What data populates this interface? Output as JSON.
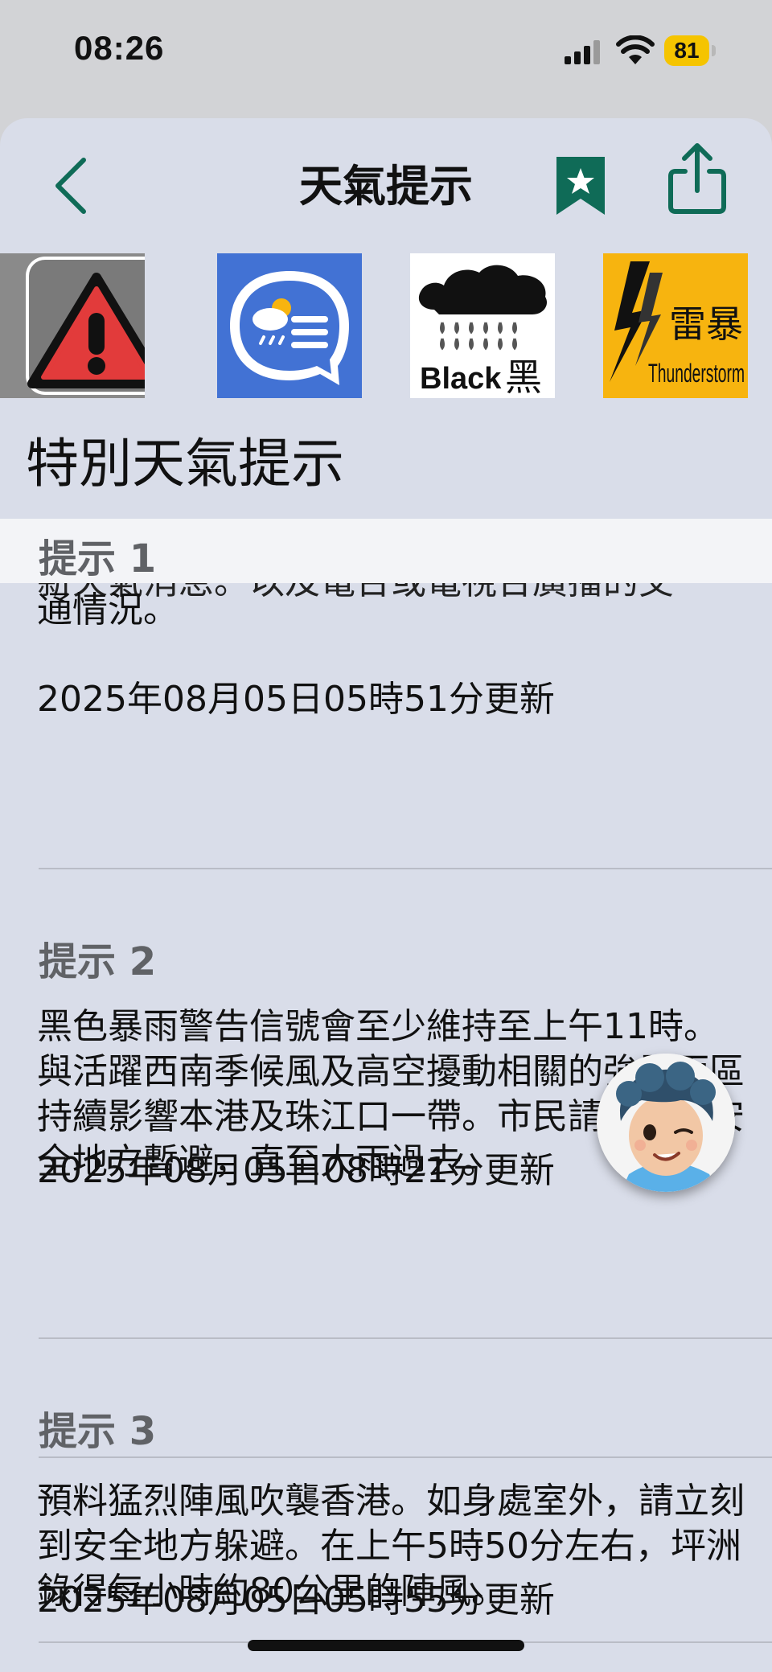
{
  "status_bar": {
    "time": "08:26",
    "battery": "81"
  },
  "nav": {
    "title": "天氣提示"
  },
  "tiles": {
    "black_label_en": "Black",
    "black_label_zh": "黑",
    "thunder_label_zh": "雷暴",
    "thunder_label_en": "Thunderstorm"
  },
  "section_title": "特別天氣提示",
  "sticky_header": "提示 1",
  "tips": [
    {
      "text_cut": "新天氣消息。以及電台或電視台廣播的交",
      "text": "通情況。",
      "time": "2025年08月05日05時51分更新"
    },
    {
      "heading": "提示 2",
      "text": "黑色暴雨警告信號會至少維持至上午11時。與活躍西南季候風及高空擾動相關的強雷雨區持續影響本港及珠江口一帶。市民請繼續在安全地方暫避，直至大雨過去。",
      "time": "2025年08月05日08時21分更新"
    },
    {
      "heading": "提示 3",
      "text": "預料猛烈陣風吹襲香港。如身處室外，請立刻到安全地方躲避。在上午5時50分左右，坪洲錄得每小時約80公里的陣風。",
      "time": "2025年08月05日05時55分更新"
    }
  ],
  "colors": {
    "accent_green": "#0f6b57",
    "sheet_bg": "#d9dde9",
    "thunder_tile": "#f7b40f",
    "info_tile": "#4272d4"
  },
  "icons": {
    "back": "chevron-left-icon",
    "bookmark": "bookmark-star-icon",
    "share": "share-icon",
    "warning": "warning-triangle-icon",
    "info": "weather-info-bubble-icon",
    "black_rain": "black-rainstorm-icon",
    "thunder": "thunderstorm-icon",
    "avatar": "assistant-avatar"
  }
}
